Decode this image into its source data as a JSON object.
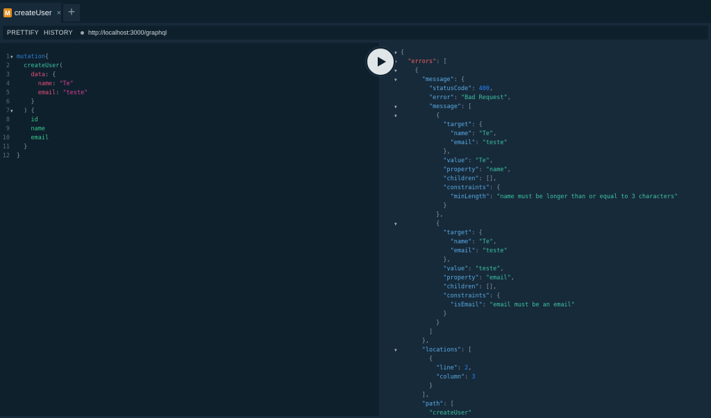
{
  "tab": {
    "badge": "M",
    "title": "createUser",
    "close_icon": "×",
    "add_icon": "+"
  },
  "toolbar": {
    "prettify_label": "PRETTIFY",
    "history_label": "HISTORY",
    "url": "http://localhost:3000/graphql"
  },
  "editor": {
    "lines": [
      {
        "n": "1",
        "fold": true,
        "tokens": [
          {
            "t": "mutation",
            "c": "kw"
          },
          {
            "t": "{",
            "c": "punct"
          }
        ]
      },
      {
        "n": "2",
        "fold": false,
        "tokens": [
          {
            "t": "  createUser",
            "c": "def"
          },
          {
            "t": "(",
            "c": "punct"
          }
        ]
      },
      {
        "n": "3",
        "fold": false,
        "tokens": [
          {
            "t": "    data",
            "c": "arg"
          },
          {
            "t": ": {",
            "c": "punct"
          }
        ]
      },
      {
        "n": "4",
        "fold": false,
        "tokens": [
          {
            "t": "      name",
            "c": "arg"
          },
          {
            "t": ": ",
            "c": "punct"
          },
          {
            "t": "\"Te\"",
            "c": "str"
          }
        ]
      },
      {
        "n": "5",
        "fold": false,
        "tokens": [
          {
            "t": "      email",
            "c": "arg"
          },
          {
            "t": ": ",
            "c": "punct"
          },
          {
            "t": "\"teste\"",
            "c": "str"
          }
        ]
      },
      {
        "n": "6",
        "fold": false,
        "tokens": [
          {
            "t": "    }",
            "c": "punct"
          }
        ]
      },
      {
        "n": "7",
        "fold": true,
        "tokens": [
          {
            "t": "  ) {",
            "c": "punct"
          }
        ]
      },
      {
        "n": "8",
        "fold": false,
        "tokens": [
          {
            "t": "    id",
            "c": "field"
          }
        ]
      },
      {
        "n": "9",
        "fold": false,
        "tokens": [
          {
            "t": "    name",
            "c": "field"
          }
        ]
      },
      {
        "n": "10",
        "fold": false,
        "tokens": [
          {
            "t": "    email",
            "c": "field"
          }
        ]
      },
      {
        "n": "11",
        "fold": false,
        "tokens": [
          {
            "t": "  }",
            "c": "punct"
          }
        ]
      },
      {
        "n": "12",
        "fold": false,
        "tokens": [
          {
            "t": "}",
            "c": "punct"
          }
        ]
      }
    ]
  },
  "result": {
    "lines": [
      {
        "fold": true,
        "tokens": [
          {
            "t": "{",
            "c": "punct"
          }
        ]
      },
      {
        "fold": true,
        "tokens": [
          {
            "t": "  ",
            "c": "punct"
          },
          {
            "t": "\"errors\"",
            "c": "errkey"
          },
          {
            "t": ": [",
            "c": "punct"
          }
        ]
      },
      {
        "fold": true,
        "tokens": [
          {
            "t": "    {",
            "c": "punct"
          }
        ]
      },
      {
        "fold": true,
        "tokens": [
          {
            "t": "      ",
            "c": "punct"
          },
          {
            "t": "\"message\"",
            "c": "key"
          },
          {
            "t": ": {",
            "c": "punct"
          }
        ]
      },
      {
        "fold": false,
        "tokens": [
          {
            "t": "        ",
            "c": "punct"
          },
          {
            "t": "\"statusCode\"",
            "c": "key"
          },
          {
            "t": ": ",
            "c": "punct"
          },
          {
            "t": "400",
            "c": "num"
          },
          {
            "t": ",",
            "c": "punct"
          }
        ]
      },
      {
        "fold": false,
        "tokens": [
          {
            "t": "        ",
            "c": "punct"
          },
          {
            "t": "\"error\"",
            "c": "key"
          },
          {
            "t": ": ",
            "c": "punct"
          },
          {
            "t": "\"Bad Request\"",
            "c": "str"
          },
          {
            "t": ",",
            "c": "punct"
          }
        ]
      },
      {
        "fold": true,
        "tokens": [
          {
            "t": "        ",
            "c": "punct"
          },
          {
            "t": "\"message\"",
            "c": "key"
          },
          {
            "t": ": [",
            "c": "punct"
          }
        ]
      },
      {
        "fold": true,
        "tokens": [
          {
            "t": "          {",
            "c": "punct"
          }
        ]
      },
      {
        "fold": false,
        "tokens": [
          {
            "t": "            ",
            "c": "punct"
          },
          {
            "t": "\"target\"",
            "c": "key"
          },
          {
            "t": ": {",
            "c": "punct"
          }
        ]
      },
      {
        "fold": false,
        "tokens": [
          {
            "t": "              ",
            "c": "punct"
          },
          {
            "t": "\"name\"",
            "c": "key"
          },
          {
            "t": ": ",
            "c": "punct"
          },
          {
            "t": "\"Te\"",
            "c": "str"
          },
          {
            "t": ",",
            "c": "punct"
          }
        ]
      },
      {
        "fold": false,
        "tokens": [
          {
            "t": "              ",
            "c": "punct"
          },
          {
            "t": "\"email\"",
            "c": "key"
          },
          {
            "t": ": ",
            "c": "punct"
          },
          {
            "t": "\"teste\"",
            "c": "str"
          }
        ]
      },
      {
        "fold": false,
        "tokens": [
          {
            "t": "            },",
            "c": "punct"
          }
        ]
      },
      {
        "fold": false,
        "tokens": [
          {
            "t": "            ",
            "c": "punct"
          },
          {
            "t": "\"value\"",
            "c": "key"
          },
          {
            "t": ": ",
            "c": "punct"
          },
          {
            "t": "\"Te\"",
            "c": "str"
          },
          {
            "t": ",",
            "c": "punct"
          }
        ]
      },
      {
        "fold": false,
        "tokens": [
          {
            "t": "            ",
            "c": "punct"
          },
          {
            "t": "\"property\"",
            "c": "key"
          },
          {
            "t": ": ",
            "c": "punct"
          },
          {
            "t": "\"name\"",
            "c": "str"
          },
          {
            "t": ",",
            "c": "punct"
          }
        ]
      },
      {
        "fold": false,
        "tokens": [
          {
            "t": "            ",
            "c": "punct"
          },
          {
            "t": "\"children\"",
            "c": "key"
          },
          {
            "t": ": [],",
            "c": "punct"
          }
        ]
      },
      {
        "fold": false,
        "tokens": [
          {
            "t": "            ",
            "c": "punct"
          },
          {
            "t": "\"constraints\"",
            "c": "key"
          },
          {
            "t": ": {",
            "c": "punct"
          }
        ]
      },
      {
        "fold": false,
        "tokens": [
          {
            "t": "              ",
            "c": "punct"
          },
          {
            "t": "\"minLength\"",
            "c": "key"
          },
          {
            "t": ": ",
            "c": "punct"
          },
          {
            "t": "\"name must be longer than or equal to 3 characters\"",
            "c": "str"
          }
        ]
      },
      {
        "fold": false,
        "tokens": [
          {
            "t": "            }",
            "c": "punct"
          }
        ]
      },
      {
        "fold": false,
        "tokens": [
          {
            "t": "          },",
            "c": "punct"
          }
        ]
      },
      {
        "fold": true,
        "tokens": [
          {
            "t": "          {",
            "c": "punct"
          }
        ]
      },
      {
        "fold": false,
        "tokens": [
          {
            "t": "            ",
            "c": "punct"
          },
          {
            "t": "\"target\"",
            "c": "key"
          },
          {
            "t": ": {",
            "c": "punct"
          }
        ]
      },
      {
        "fold": false,
        "tokens": [
          {
            "t": "              ",
            "c": "punct"
          },
          {
            "t": "\"name\"",
            "c": "key"
          },
          {
            "t": ": ",
            "c": "punct"
          },
          {
            "t": "\"Te\"",
            "c": "str"
          },
          {
            "t": ",",
            "c": "punct"
          }
        ]
      },
      {
        "fold": false,
        "tokens": [
          {
            "t": "              ",
            "c": "punct"
          },
          {
            "t": "\"email\"",
            "c": "key"
          },
          {
            "t": ": ",
            "c": "punct"
          },
          {
            "t": "\"teste\"",
            "c": "str"
          }
        ]
      },
      {
        "fold": false,
        "tokens": [
          {
            "t": "            },",
            "c": "punct"
          }
        ]
      },
      {
        "fold": false,
        "tokens": [
          {
            "t": "            ",
            "c": "punct"
          },
          {
            "t": "\"value\"",
            "c": "key"
          },
          {
            "t": ": ",
            "c": "punct"
          },
          {
            "t": "\"teste\"",
            "c": "str"
          },
          {
            "t": ",",
            "c": "punct"
          }
        ]
      },
      {
        "fold": false,
        "tokens": [
          {
            "t": "            ",
            "c": "punct"
          },
          {
            "t": "\"property\"",
            "c": "key"
          },
          {
            "t": ": ",
            "c": "punct"
          },
          {
            "t": "\"email\"",
            "c": "str"
          },
          {
            "t": ",",
            "c": "punct"
          }
        ]
      },
      {
        "fold": false,
        "tokens": [
          {
            "t": "            ",
            "c": "punct"
          },
          {
            "t": "\"children\"",
            "c": "key"
          },
          {
            "t": ": [],",
            "c": "punct"
          }
        ]
      },
      {
        "fold": false,
        "tokens": [
          {
            "t": "            ",
            "c": "punct"
          },
          {
            "t": "\"constraints\"",
            "c": "key"
          },
          {
            "t": ": {",
            "c": "punct"
          }
        ]
      },
      {
        "fold": false,
        "tokens": [
          {
            "t": "              ",
            "c": "punct"
          },
          {
            "t": "\"isEmail\"",
            "c": "key"
          },
          {
            "t": ": ",
            "c": "punct"
          },
          {
            "t": "\"email must be an email\"",
            "c": "str"
          }
        ]
      },
      {
        "fold": false,
        "tokens": [
          {
            "t": "            }",
            "c": "punct"
          }
        ]
      },
      {
        "fold": false,
        "tokens": [
          {
            "t": "          }",
            "c": "punct"
          }
        ]
      },
      {
        "fold": false,
        "tokens": [
          {
            "t": "        ]",
            "c": "punct"
          }
        ]
      },
      {
        "fold": false,
        "tokens": [
          {
            "t": "      },",
            "c": "punct"
          }
        ]
      },
      {
        "fold": true,
        "tokens": [
          {
            "t": "      ",
            "c": "punct"
          },
          {
            "t": "\"locations\"",
            "c": "key"
          },
          {
            "t": ": [",
            "c": "punct"
          }
        ]
      },
      {
        "fold": false,
        "tokens": [
          {
            "t": "        {",
            "c": "punct"
          }
        ]
      },
      {
        "fold": false,
        "tokens": [
          {
            "t": "          ",
            "c": "punct"
          },
          {
            "t": "\"line\"",
            "c": "key"
          },
          {
            "t": ": ",
            "c": "punct"
          },
          {
            "t": "2",
            "c": "num"
          },
          {
            "t": ",",
            "c": "punct"
          }
        ]
      },
      {
        "fold": false,
        "tokens": [
          {
            "t": "          ",
            "c": "punct"
          },
          {
            "t": "\"column\"",
            "c": "key"
          },
          {
            "t": ": ",
            "c": "punct"
          },
          {
            "t": "3",
            "c": "num"
          }
        ]
      },
      {
        "fold": false,
        "tokens": [
          {
            "t": "        }",
            "c": "punct"
          }
        ]
      },
      {
        "fold": false,
        "tokens": [
          {
            "t": "      ],",
            "c": "punct"
          }
        ]
      },
      {
        "fold": false,
        "tokens": [
          {
            "t": "      ",
            "c": "punct"
          },
          {
            "t": "\"path\"",
            "c": "key"
          },
          {
            "t": ": [",
            "c": "punct"
          }
        ]
      },
      {
        "fold": false,
        "tokens": [
          {
            "t": "        ",
            "c": "punct"
          },
          {
            "t": "\"createUser\"",
            "c": "str"
          }
        ]
      }
    ]
  }
}
